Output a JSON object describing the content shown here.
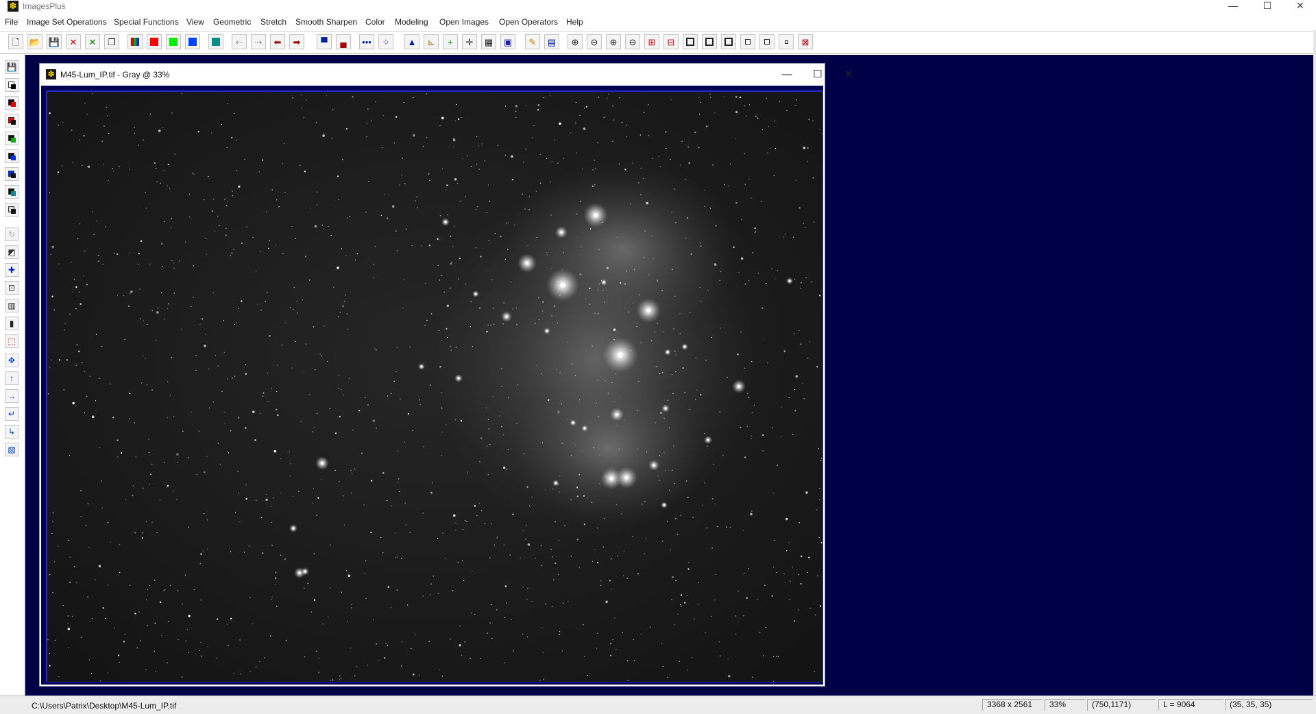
{
  "app": {
    "title": "ImagesPlus",
    "minimize_symbol": "—",
    "maximize_symbol": "☐",
    "close_symbol": "✕"
  },
  "menu": [
    "File",
    "Image Set Operations",
    "Special Functions",
    "View",
    "Geometric",
    "Stretch",
    "Smooth Sharpen",
    "Color",
    "Modeling",
    "Open Images",
    "Open Operators",
    "Help"
  ],
  "toolbar": [
    {
      "name": "new-file-icon",
      "glyph": "🗋"
    },
    {
      "name": "open-folder-icon",
      "glyph": "📂"
    },
    {
      "name": "save-icon",
      "glyph": "💾"
    },
    {
      "name": "close-red-x-icon",
      "glyph": "✕",
      "color": "#d00000"
    },
    {
      "name": "close-green-x-icon",
      "glyph": "✕",
      "color": "#008000"
    },
    {
      "name": "copy-images-icon",
      "glyph": "❐"
    },
    {
      "name": "rgb-channels-icon",
      "type": "bars",
      "colors": [
        "#e00000",
        "#00b000",
        "#0030e0"
      ]
    },
    {
      "name": "red-channel-icon",
      "type": "swatch",
      "color": "#ff0000"
    },
    {
      "name": "green-channel-icon",
      "type": "swatch",
      "color": "#00ee00"
    },
    {
      "name": "blue-channel-icon",
      "type": "swatch",
      "color": "#0044ff"
    },
    {
      "name": "teal-layer-icon",
      "type": "swatch",
      "color": "#0b8a8a"
    },
    {
      "name": "arrow-left-light-icon",
      "glyph": "⇠",
      "color": "#9a9a9a"
    },
    {
      "name": "arrow-right-light-icon",
      "glyph": "⇢",
      "color": "#9a9a9a"
    },
    {
      "name": "arrow-left-icon",
      "glyph": "⬅",
      "color": "#9a0000"
    },
    {
      "name": "arrow-right-icon",
      "glyph": "➡",
      "color": "#9a0000"
    },
    {
      "name": "stack-top-icon",
      "glyph": "▀",
      "color": "#0020a0"
    },
    {
      "name": "stack-bottom-icon",
      "glyph": "▄",
      "color": "#a00000"
    },
    {
      "name": "dots-line-icon",
      "glyph": "•••",
      "color": "#0020a0"
    },
    {
      "name": "dots-graph-icon",
      "glyph": "⁘",
      "color": "#0020a0"
    },
    {
      "name": "histogram-icon",
      "glyph": "▲",
      "color": "#0020a0"
    },
    {
      "name": "curve-graph-icon",
      "glyph": "⊾",
      "color": "#a07000"
    },
    {
      "name": "add-point-icon",
      "glyph": "+",
      "color": "#008000"
    },
    {
      "name": "crosshair-icon",
      "glyph": "✛"
    },
    {
      "name": "grid-panel-icon",
      "glyph": "▦"
    },
    {
      "name": "palette-panel-icon",
      "glyph": "▣",
      "color": "#2020a0"
    },
    {
      "name": "pencil-icon",
      "glyph": "✎",
      "color": "#c08000"
    },
    {
      "name": "filter-panel-icon",
      "glyph": "▤",
      "color": "#0020a0"
    },
    {
      "name": "zoom-in-icon",
      "glyph": "⊕"
    },
    {
      "name": "zoom-out-icon",
      "glyph": "⊖"
    },
    {
      "name": "zoom-in-alt-icon",
      "glyph": "⊕"
    },
    {
      "name": "zoom-out-alt-icon",
      "glyph": "⊖"
    },
    {
      "name": "zoom-max-icon",
      "glyph": "⊞",
      "color": "#d00000"
    },
    {
      "name": "zoom-min-icon",
      "glyph": "⊟",
      "color": "#d00000"
    },
    {
      "name": "box-large-icon",
      "type": "box",
      "size": "l"
    },
    {
      "name": "box-large-alt-icon",
      "type": "box",
      "size": "l"
    },
    {
      "name": "box-medium-icon",
      "type": "box",
      "size": "m"
    },
    {
      "name": "box-small-icon",
      "type": "box",
      "size": "s"
    },
    {
      "name": "box-smaller-icon",
      "type": "box",
      "size": "s"
    },
    {
      "name": "box-tiny-icon",
      "type": "box",
      "size": "xs"
    },
    {
      "name": "fit-window-icon",
      "glyph": "⊠",
      "color": "#b00000"
    }
  ],
  "left_toolbar": [
    {
      "name": "save-all-icon",
      "glyph": "💾"
    },
    {
      "name": "swap-white-black-icon",
      "colors": [
        "#ffffff",
        "#000000"
      ]
    },
    {
      "name": "swap-black-red-icon",
      "colors": [
        "#111111",
        "#e00000"
      ]
    },
    {
      "name": "swap-black-red2-icon",
      "colors": [
        "#e00000",
        "#111111"
      ]
    },
    {
      "name": "swap-black-green-icon",
      "colors": [
        "#111111",
        "#00b000"
      ]
    },
    {
      "name": "swap-black-blue-icon",
      "colors": [
        "#111111",
        "#0030e0"
      ]
    },
    {
      "name": "swap-blue-black-icon",
      "colors": [
        "#0030e0",
        "#111111"
      ]
    },
    {
      "name": "swap-black-teal-icon",
      "colors": [
        "#111111",
        "#0b8a8a"
      ]
    },
    {
      "name": "swap-gray-black-icon",
      "colors": [
        "#d8d8d8",
        "#111111"
      ]
    },
    {
      "name": "undo-disabled-icon",
      "glyph": "↻",
      "color": "#a8a8a8"
    },
    {
      "name": "gradient-icon",
      "glyph": "◩",
      "color": "#333333"
    },
    {
      "name": "star-plus-icon",
      "glyph": "✚",
      "color": "#0020c0"
    },
    {
      "name": "frame-select-icon",
      "glyph": "⊡"
    },
    {
      "name": "columns-icon",
      "glyph": "▥"
    },
    {
      "name": "black-bar-icon",
      "glyph": "▮"
    },
    {
      "name": "crop-select-icon",
      "glyph": "⬚",
      "color": "#c00000"
    },
    {
      "name": "move-cross-icon",
      "glyph": "✥",
      "color": "#0040d0"
    },
    {
      "name": "arrow-up-icon",
      "glyph": "↑",
      "color": "#0040d0"
    },
    {
      "name": "arrow-right-blue-icon",
      "glyph": "→",
      "color": "#0040d0"
    },
    {
      "name": "return-left-icon",
      "glyph": "↵",
      "color": "#0040d0"
    },
    {
      "name": "return-down-icon",
      "glyph": "↳",
      "color": "#0040d0"
    },
    {
      "name": "info-panel-icon",
      "glyph": "▧",
      "color": "#0040d0"
    }
  ],
  "image_window": {
    "title": "M45-Lum_IP.tif - Gray @ 33%",
    "minimize_symbol": "—",
    "maximize_symbol": "☐",
    "close_symbol": "✕"
  },
  "status": {
    "path": "C:\\Users\\Patrix\\Desktop\\M45-Lum_IP.tif",
    "dimensions": "3368 x 2561",
    "zoom": "33%",
    "cursor": "(750,1171)",
    "luminance": "L = 9064",
    "rgb": "(35, 35, 35)"
  },
  "colors": {
    "workspace": "#000046",
    "image_frame": "#000050",
    "image_background": "#1a1a1a"
  }
}
